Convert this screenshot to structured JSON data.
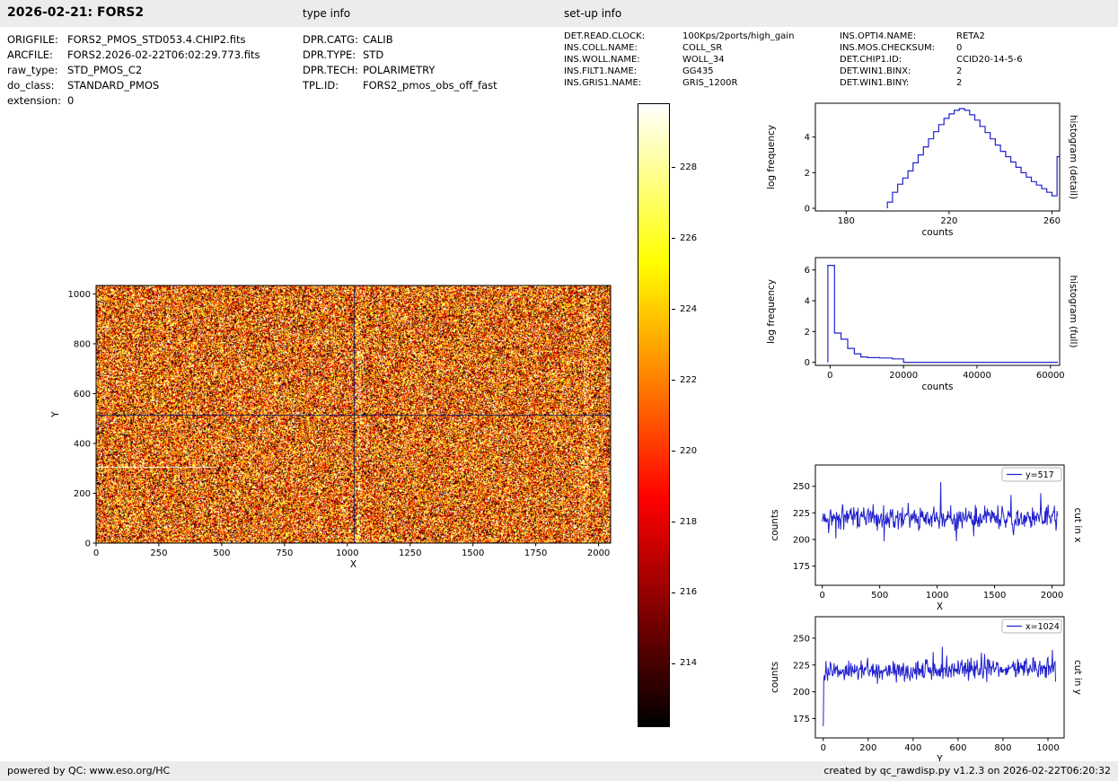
{
  "header": {
    "title": "2026-02-21: FORS2",
    "type_info_label": "type info",
    "setup_info_label": "set-up info"
  },
  "metadata": {
    "col1": [
      {
        "label": "ORIGFILE:",
        "value": "FORS2_PMOS_STD053.4.CHIP2.fits"
      },
      {
        "label": "ARCFILE:",
        "value": "FORS2.2026-02-22T06:02:29.773.fits"
      },
      {
        "label": "raw_type:",
        "value": "STD_PMOS_C2"
      },
      {
        "label": "do_class:",
        "value": "STANDARD_PMOS"
      },
      {
        "label": "extension:",
        "value": "0"
      }
    ],
    "col2": [
      {
        "label": "DPR.CATG:",
        "value": "CALIB"
      },
      {
        "label": "DPR.TYPE:",
        "value": "STD"
      },
      {
        "label": "DPR.TECH:",
        "value": "POLARIMETRY"
      },
      {
        "label": "TPL.ID:",
        "value": "FORS2_pmos_obs_off_fast"
      }
    ],
    "col3": [
      {
        "label": "DET.READ.CLOCK:",
        "value": "100Kps/2ports/high_gain"
      },
      {
        "label": "INS.COLL.NAME:",
        "value": "COLL_SR"
      },
      {
        "label": "INS.WOLL.NAME:",
        "value": "WOLL_34"
      },
      {
        "label": "INS.FILT1.NAME:",
        "value": "GG435"
      },
      {
        "label": "INS.GRIS1.NAME:",
        "value": "GRIS_1200R"
      }
    ],
    "col4": [
      {
        "label": "INS.OPTI4.NAME:",
        "value": "RETA2"
      },
      {
        "label": "INS.MOS.CHECKSUM:",
        "value": "0"
      },
      {
        "label": "DET.CHIP1.ID:",
        "value": "CCID20-14-5-6"
      },
      {
        "label": "DET.WIN1.BINX:",
        "value": "2"
      },
      {
        "label": "DET.WIN1.BINY:",
        "value": "2"
      }
    ]
  },
  "footer": {
    "left": "powered by QC: www.eso.org/HC",
    "right": "created by qc_rawdisp.py v1.2.3 on 2026-02-22T06:20:32"
  },
  "chart_data": [
    {
      "id": "raw_image",
      "type": "heatmap",
      "xlabel": "X",
      "ylabel": "Y",
      "xlim": [
        0,
        2048
      ],
      "ylim": [
        0,
        1034
      ],
      "xticks": [
        0,
        250,
        500,
        750,
        1000,
        1250,
        1500,
        1750,
        2000
      ],
      "yticks": [
        0,
        200,
        400,
        600,
        800,
        1000
      ],
      "colormap": "hot",
      "value_range": [
        212.2,
        229.8
      ],
      "mean_counts": 222,
      "noise_sd": 6,
      "crosshair": {
        "x": 1024,
        "y": 517
      },
      "crosshair_color": "#1a1a5e",
      "bright_line": {
        "y": 305,
        "x_from": 0,
        "x_to": 480
      },
      "seed": 42
    },
    {
      "id": "colorbar",
      "type": "colorbar",
      "colormap": "hot",
      "range": [
        212.2,
        229.8
      ],
      "ticks": [
        214,
        216,
        218,
        220,
        222,
        224,
        226,
        228
      ]
    },
    {
      "id": "hist_detail",
      "type": "histogram",
      "xlabel": "counts",
      "ylabel": "log frequency",
      "right_label": "histogram (detail)",
      "xlim": [
        168,
        263
      ],
      "ylim": [
        -0.15,
        5.9
      ],
      "xticks": [
        180,
        220,
        260
      ],
      "yticks": [
        0,
        2,
        4
      ],
      "color": "#2222cc",
      "bin_edges": [
        196,
        198,
        200,
        202,
        204,
        206,
        208,
        210,
        212,
        214,
        216,
        218,
        220,
        222,
        224,
        226,
        228,
        230,
        232,
        234,
        236,
        238,
        240,
        242,
        244,
        246,
        248,
        250,
        252,
        254,
        256,
        258,
        260,
        262,
        263.2
      ],
      "values": [
        0.35,
        0.9,
        1.35,
        1.7,
        2.1,
        2.55,
        3.0,
        3.45,
        3.9,
        4.3,
        4.7,
        5.05,
        5.3,
        5.5,
        5.6,
        5.5,
        5.25,
        4.95,
        4.6,
        4.25,
        3.9,
        3.55,
        3.2,
        2.9,
        2.6,
        2.3,
        2.0,
        1.75,
        1.5,
        1.3,
        1.1,
        0.9,
        0.7,
        2.9
      ]
    },
    {
      "id": "hist_full",
      "type": "histogram",
      "xlabel": "counts",
      "ylabel": "log frequency",
      "right_label": "histogram (full)",
      "xlim": [
        -4000,
        62500
      ],
      "ylim": [
        -0.2,
        6.8
      ],
      "xticks": [
        0,
        20000,
        40000,
        60000
      ],
      "yticks": [
        0,
        2,
        4,
        6
      ],
      "color": "#2222cc",
      "bin_edges": [
        -600,
        1200,
        3000,
        4800,
        6600,
        8400,
        10200,
        13500,
        17000,
        20000,
        62000
      ],
      "values": [
        6.3,
        1.9,
        1.5,
        0.9,
        0.55,
        0.35,
        0.3,
        0.28,
        0.22,
        0.0
      ]
    },
    {
      "id": "cut_x",
      "type": "line",
      "xlabel": "X",
      "ylabel": "counts",
      "right_label": "cut in x",
      "legend": "y=517",
      "xlim": [
        -60,
        2105
      ],
      "ylim": [
        157,
        270
      ],
      "xticks": [
        0,
        500,
        1000,
        1500,
        2000
      ],
      "yticks": [
        175,
        200,
        225,
        250
      ],
      "color": "#2222cc",
      "series_params": {
        "n": 450,
        "x_start": 0,
        "x_end": 2048,
        "mean": 220.5,
        "sd": 5.2,
        "trend": 0,
        "seed": 13,
        "spikes": [
          {
            "x": 1032,
            "y": 254
          },
          {
            "x": 1640,
            "y": 242
          },
          {
            "x": 120,
            "y": 201
          }
        ]
      }
    },
    {
      "id": "cut_y",
      "type": "line",
      "xlabel": "Y",
      "ylabel": "counts",
      "right_label": "cut in y",
      "legend": "x=1024",
      "xlim": [
        -35,
        1072
      ],
      "ylim": [
        157,
        270
      ],
      "xticks": [
        0,
        200,
        400,
        600,
        800,
        1000
      ],
      "yticks": [
        175,
        200,
        225,
        250
      ],
      "color": "#2222cc",
      "series_params": {
        "n": 430,
        "x_start": 0,
        "x_end": 1034,
        "mean": 218.5,
        "sd": 4.8,
        "trend": 4,
        "seed": 29,
        "start_dip": 168,
        "spikes": [
          {
            "x": 530,
            "y": 242
          },
          {
            "x": 1020,
            "y": 239
          }
        ]
      }
    }
  ]
}
